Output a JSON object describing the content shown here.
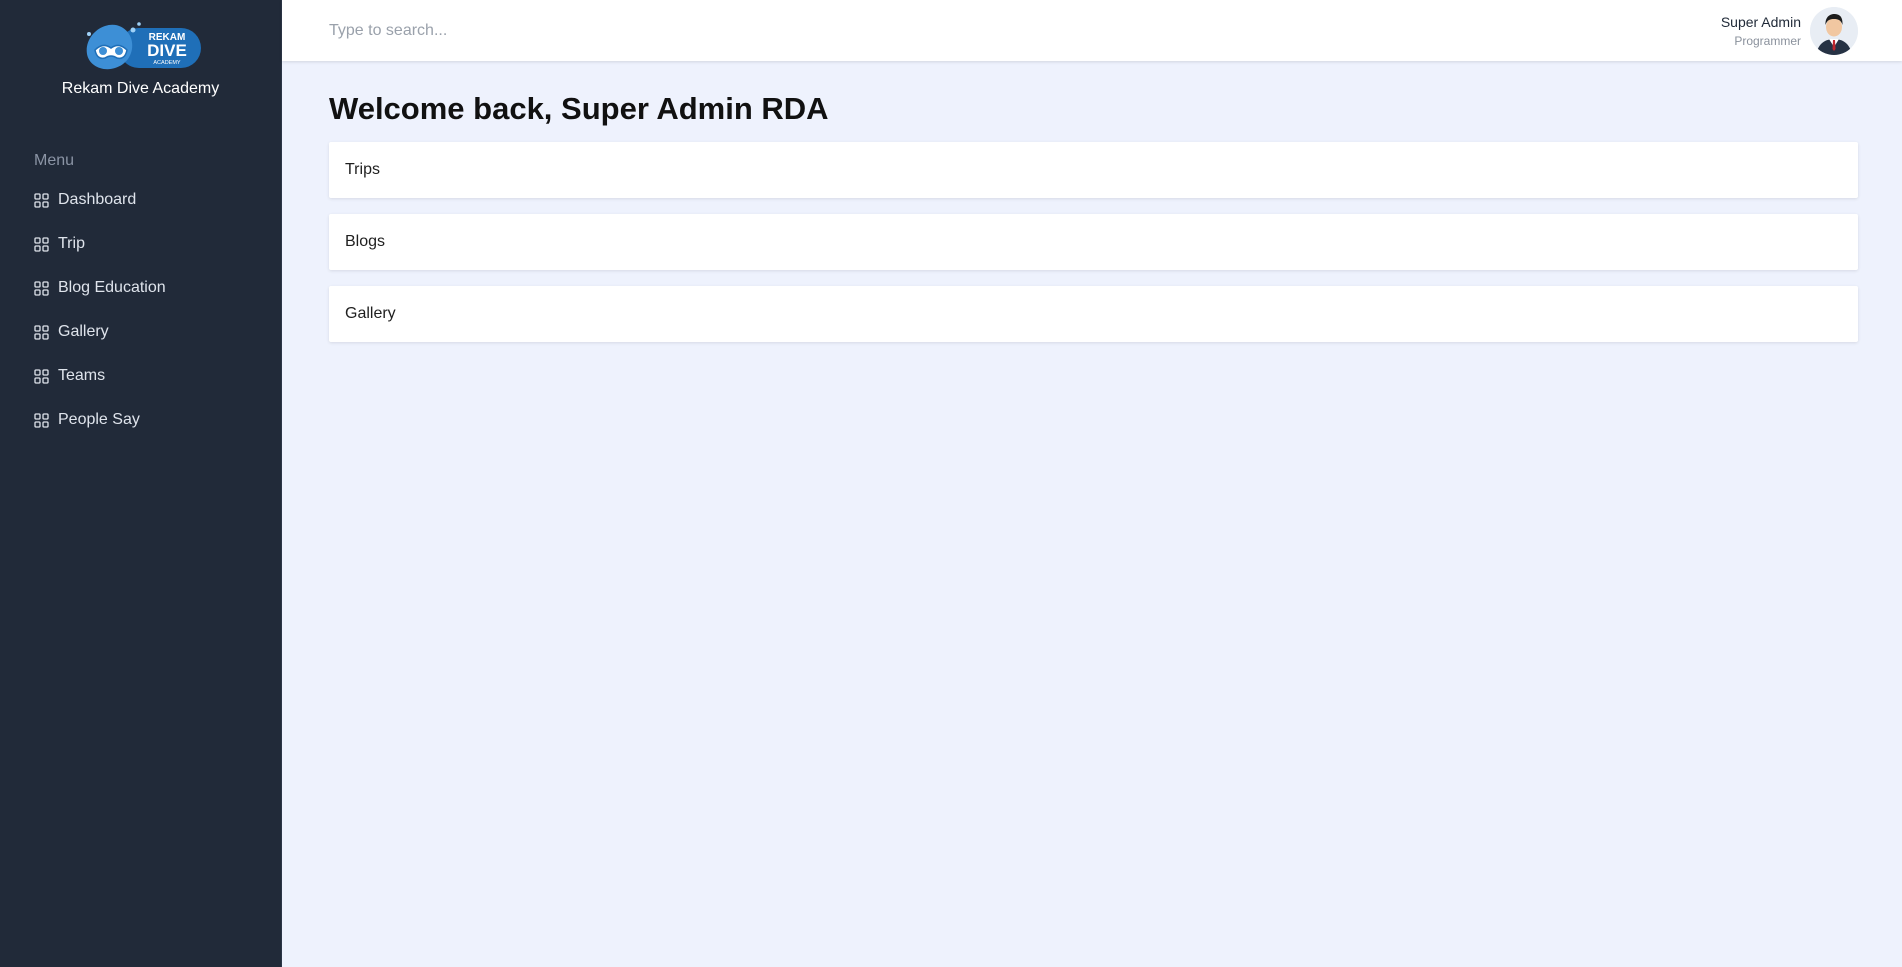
{
  "brand": {
    "logo_text_top": "REKAM",
    "logo_text_main": "DIVE",
    "logo_text_bottom": "ACADEMY",
    "name": "Rekam Dive Academy"
  },
  "sidebar": {
    "menu_label": "Menu",
    "items": [
      {
        "label": "Dashboard",
        "icon": "grid-icon"
      },
      {
        "label": "Trip",
        "icon": "grid-icon"
      },
      {
        "label": "Blog Education",
        "icon": "grid-icon"
      },
      {
        "label": "Gallery",
        "icon": "grid-icon"
      },
      {
        "label": "Teams",
        "icon": "grid-icon"
      },
      {
        "label": "People Say",
        "icon": "grid-icon"
      }
    ]
  },
  "header": {
    "search_placeholder": "Type to search...",
    "user_name": "Super Admin",
    "user_role": "Programmer"
  },
  "main": {
    "title": "Welcome back, Super Admin RDA",
    "cards": [
      {
        "label": "Trips"
      },
      {
        "label": "Blogs"
      },
      {
        "label": "Gallery"
      }
    ]
  },
  "colors": {
    "sidebar_bg": "#212a39",
    "content_bg": "#eef2fd",
    "logo_blue": "#1f6fb8"
  }
}
